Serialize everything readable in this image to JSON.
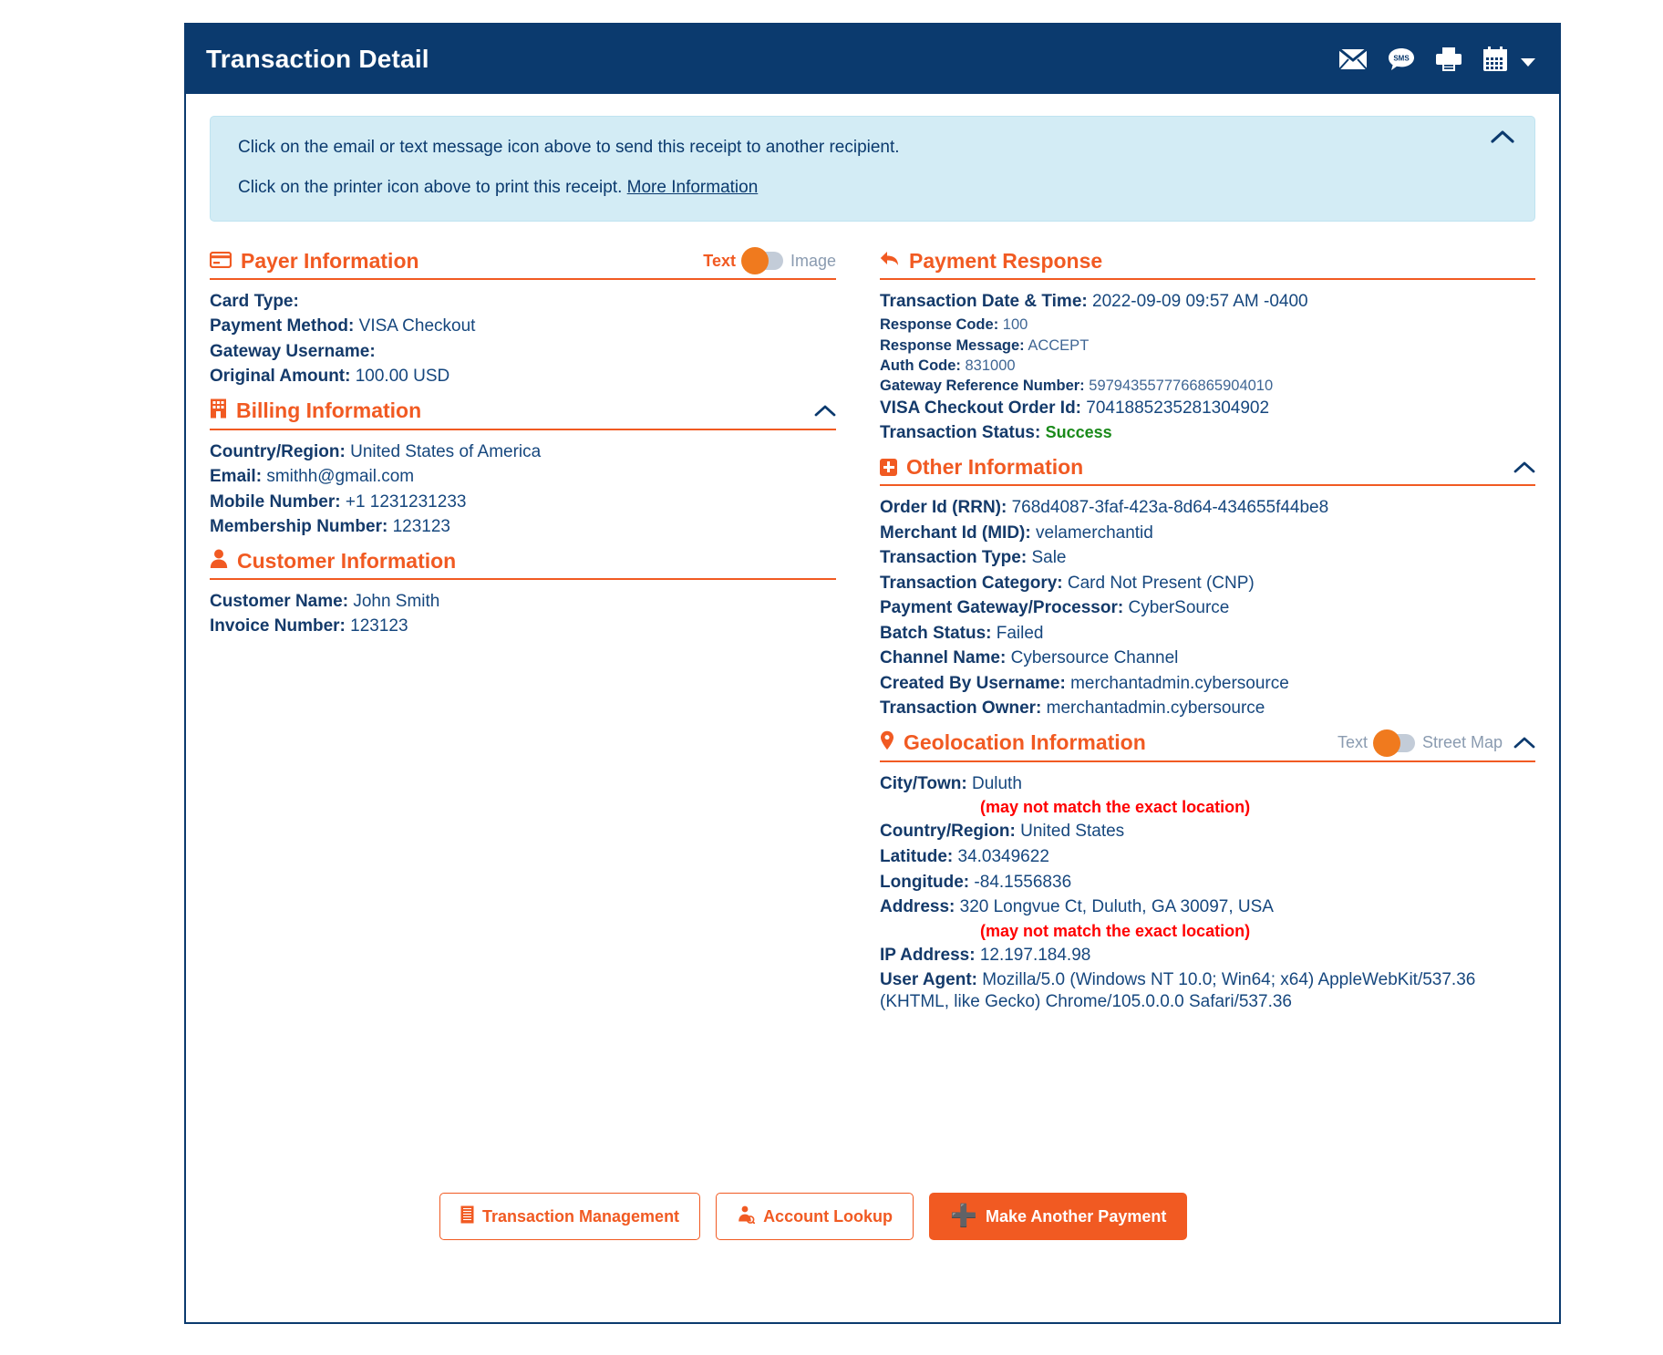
{
  "header": {
    "title": "Transaction Detail",
    "icons": [
      {
        "name": "email-icon",
        "label": "Email"
      },
      {
        "name": "sms-icon",
        "label": "SMS"
      },
      {
        "name": "printer-icon",
        "label": "Print"
      },
      {
        "name": "calendar-icon",
        "label": "Calendar"
      }
    ]
  },
  "banner": {
    "line1": "Click on the email or text message icon above to send this receipt to another recipient.",
    "line2_prefix": "Click on the printer icon above to print this receipt. ",
    "link": "More Information"
  },
  "payer": {
    "title": "Payer Information",
    "toggle": {
      "left": "Text",
      "right": "Image",
      "state": "left"
    },
    "fields": [
      {
        "key": "Card Type:",
        "value": ""
      },
      {
        "key": "Payment Method:",
        "value": "VISA Checkout"
      },
      {
        "key": "Gateway Username:",
        "value": ""
      },
      {
        "key": "Original Amount:",
        "value": "100.00 USD"
      }
    ]
  },
  "billing": {
    "title": "Billing Information",
    "fields": [
      {
        "key": "Country/Region:",
        "value": "United States of America"
      },
      {
        "key": "Email:",
        "value": "smithh@gmail.com"
      },
      {
        "key": "Mobile Number:",
        "value": "+1 1231231233"
      },
      {
        "key": "Membership Number:",
        "value": "123123"
      }
    ]
  },
  "customer": {
    "title": "Customer Information",
    "fields": [
      {
        "key": "Customer Name:",
        "value": "John Smith"
      },
      {
        "key": "Invoice Number:",
        "value": "123123"
      }
    ]
  },
  "payment_response": {
    "title": "Payment Response",
    "fields": [
      {
        "key": "Transaction Date & Time:",
        "value": "2022-09-09 09:57 AM -0400"
      },
      {
        "key": "Response Code:",
        "value": "100"
      },
      {
        "key": "Response Message:",
        "value": "ACCEPT"
      },
      {
        "key": "Auth Code:",
        "value": "831000"
      },
      {
        "key": "Gateway Reference Number:",
        "value": "5979435577766865904010"
      },
      {
        "key": "VISA Checkout Order Id:",
        "value": "7041885235281304902"
      }
    ],
    "status_key": "Transaction Status:",
    "status_value": "Success",
    "status_color": "#1a8a1a"
  },
  "other": {
    "title": "Other Information",
    "fields": [
      {
        "key": "Order Id (RRN):",
        "value": "768d4087-3faf-423a-8d64-434655f44be8"
      },
      {
        "key": "Merchant Id (MID):",
        "value": "velamerchantid"
      },
      {
        "key": "Transaction Type:",
        "value": "Sale"
      },
      {
        "key": "Transaction Category:",
        "value": "Card Not Present (CNP)"
      },
      {
        "key": "Payment Gateway/Processor:",
        "value": "CyberSource"
      },
      {
        "key": "Batch Status:",
        "value": "Failed"
      },
      {
        "key": "Channel Name:",
        "value": "Cybersource Channel"
      },
      {
        "key": "Created By Username:",
        "value": "merchantadmin.cybersource"
      },
      {
        "key": "Transaction Owner:",
        "value": "merchantadmin.cybersource"
      }
    ]
  },
  "geolocation": {
    "title": "Geolocation Information",
    "toggle": {
      "left": "Text",
      "right": "Street Map",
      "state": "left"
    },
    "city_key": "City/Town:",
    "city_value": "Duluth",
    "city_note": "(may not match the exact location)",
    "country_key": "Country/Region:",
    "country_value": "United States",
    "latitude_key": "Latitude:",
    "latitude_value": "34.0349622",
    "longitude_key": "Longitude:",
    "longitude_value": "-84.1556836",
    "address_key": "Address:",
    "address_value": "320 Longvue Ct, Duluth, GA 30097, USA",
    "address_note": "(may not match the exact location)",
    "ip_key": "IP Address:",
    "ip_value": "12.197.184.98",
    "ua_key": "User Agent:",
    "ua_value": "Mozilla/5.0 (Windows NT 10.0; Win64; x64) AppleWebKit/537.36 (KHTML, like Gecko) Chrome/105.0.0.0 Safari/537.36",
    "note_color": "#ff0000"
  },
  "footer": {
    "transaction_management": "Transaction Management",
    "account_lookup": "Account Lookup",
    "make_another_payment": "Make Another Payment"
  },
  "colors": {
    "header_blue": "#0b3a6e",
    "accent_orange": "#f15a22",
    "banner_blue": "#d3ecf5",
    "text_navy": "#163a6b"
  }
}
